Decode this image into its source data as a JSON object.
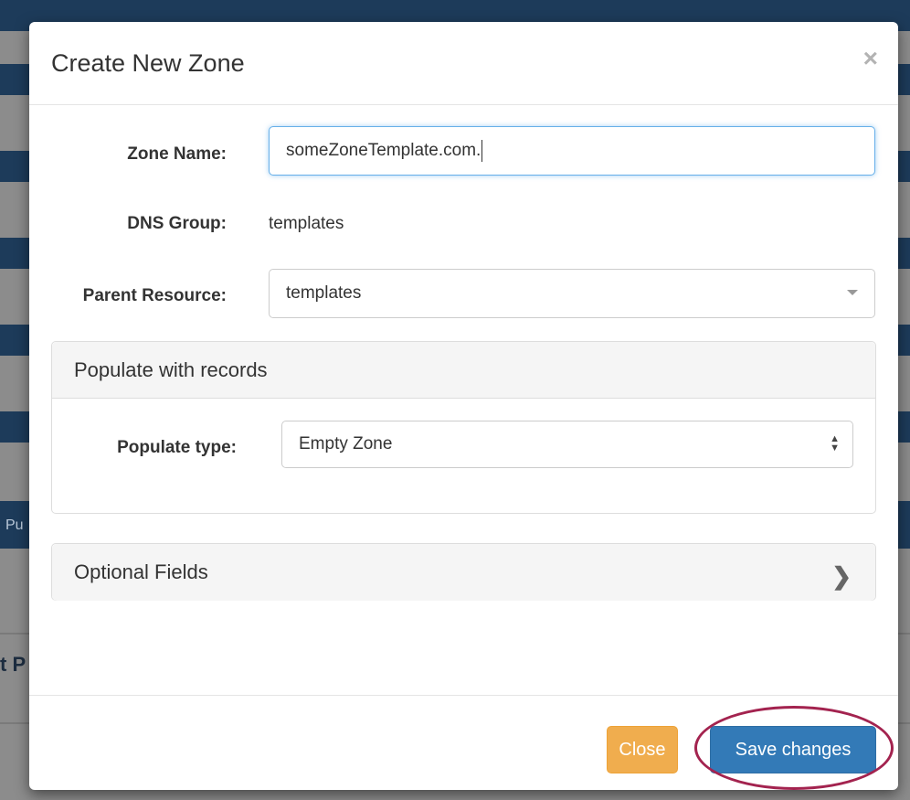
{
  "background": {
    "fragment_left": "Pu",
    "fragment_bold": "t P"
  },
  "modal": {
    "title": "Create New Zone",
    "close_glyph": "×"
  },
  "form": {
    "zone_name": {
      "label": "Zone Name:",
      "value": "someZoneTemplate.com."
    },
    "dns_group": {
      "label": "DNS Group:",
      "value": "templates"
    },
    "parent_resource": {
      "label": "Parent Resource:",
      "value": "templates"
    }
  },
  "populate_panel": {
    "heading": "Populate with records",
    "type_label": "Populate type:",
    "type_value": "Empty Zone"
  },
  "optional_panel": {
    "heading": "Optional Fields",
    "chevron_glyph": "❯"
  },
  "footer": {
    "close_label": "Close",
    "save_label": "Save changes"
  },
  "colors": {
    "save": "#337ab7",
    "close": "#f0ad4e",
    "highlight": "#a3234f"
  }
}
